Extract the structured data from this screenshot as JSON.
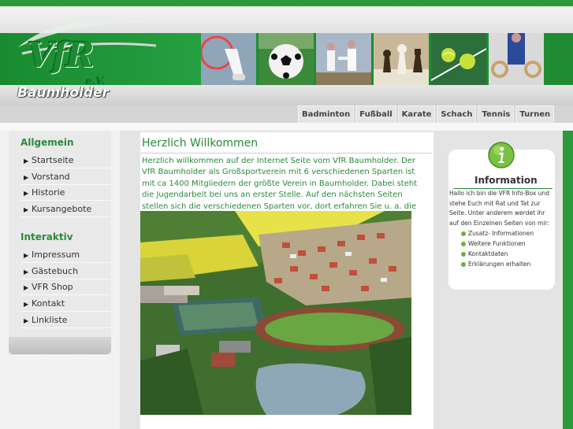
{
  "logo": {
    "brand": "VfR",
    "suffix": "e.V.",
    "town": "Baumholder"
  },
  "header_photos": [
    {
      "name": "badminton-shuttlecock-photo"
    },
    {
      "name": "soccer-ball-photo"
    },
    {
      "name": "karate-photo"
    },
    {
      "name": "chess-pieces-photo"
    },
    {
      "name": "tennis-balls-photo"
    },
    {
      "name": "gymnastics-rings-photo"
    }
  ],
  "sports_nav": [
    "Badminton",
    "Fußball",
    "Karate",
    "Schach",
    "Tennis",
    "Turnen"
  ],
  "sidebar": {
    "section1_title": "Allgemein",
    "section1_items": [
      "Startseite",
      "Vorstand",
      "Historie",
      "Kursangebote"
    ],
    "section2_title": "Interaktiv",
    "section2_items": [
      "Impressum",
      "Gästebuch",
      "VFR Shop",
      "Kontakt",
      "Linkliste"
    ]
  },
  "main": {
    "title": "Herzlich Willkommen",
    "intro": "Herzlich willkommen auf der Internet Seite vom VfR Baumholder. Der VfR Baumholder als Großsportverein mit 6 verschiedenen Sparten ist mit ca 1400 Mitgliedern der größte Verein in Baumholder. Dabei steht die Jugendarbeit bei uns an erster Stelle. Auf den nächsten Seiten stellen sich die verschiedenen Sparten vor, dort erfahren Sie u. a. die Trainingszeiten und Trainingsorte."
  },
  "infobox": {
    "title": "Information",
    "text": "Hallo ich bin die VFR Info-Box und stehe Euch mit Rat und Tat zur Seite. Unter anderem werdet ihr auf den Einzelnen Seiten von mir:",
    "bullets": [
      "Zusatz- Informationen",
      "Weitere Funktionen",
      "Kontaktdaten",
      "Erklärungen erhalten"
    ]
  },
  "colors": {
    "brand_green": "#2a8a3a",
    "band_green": "#1f8c34"
  }
}
